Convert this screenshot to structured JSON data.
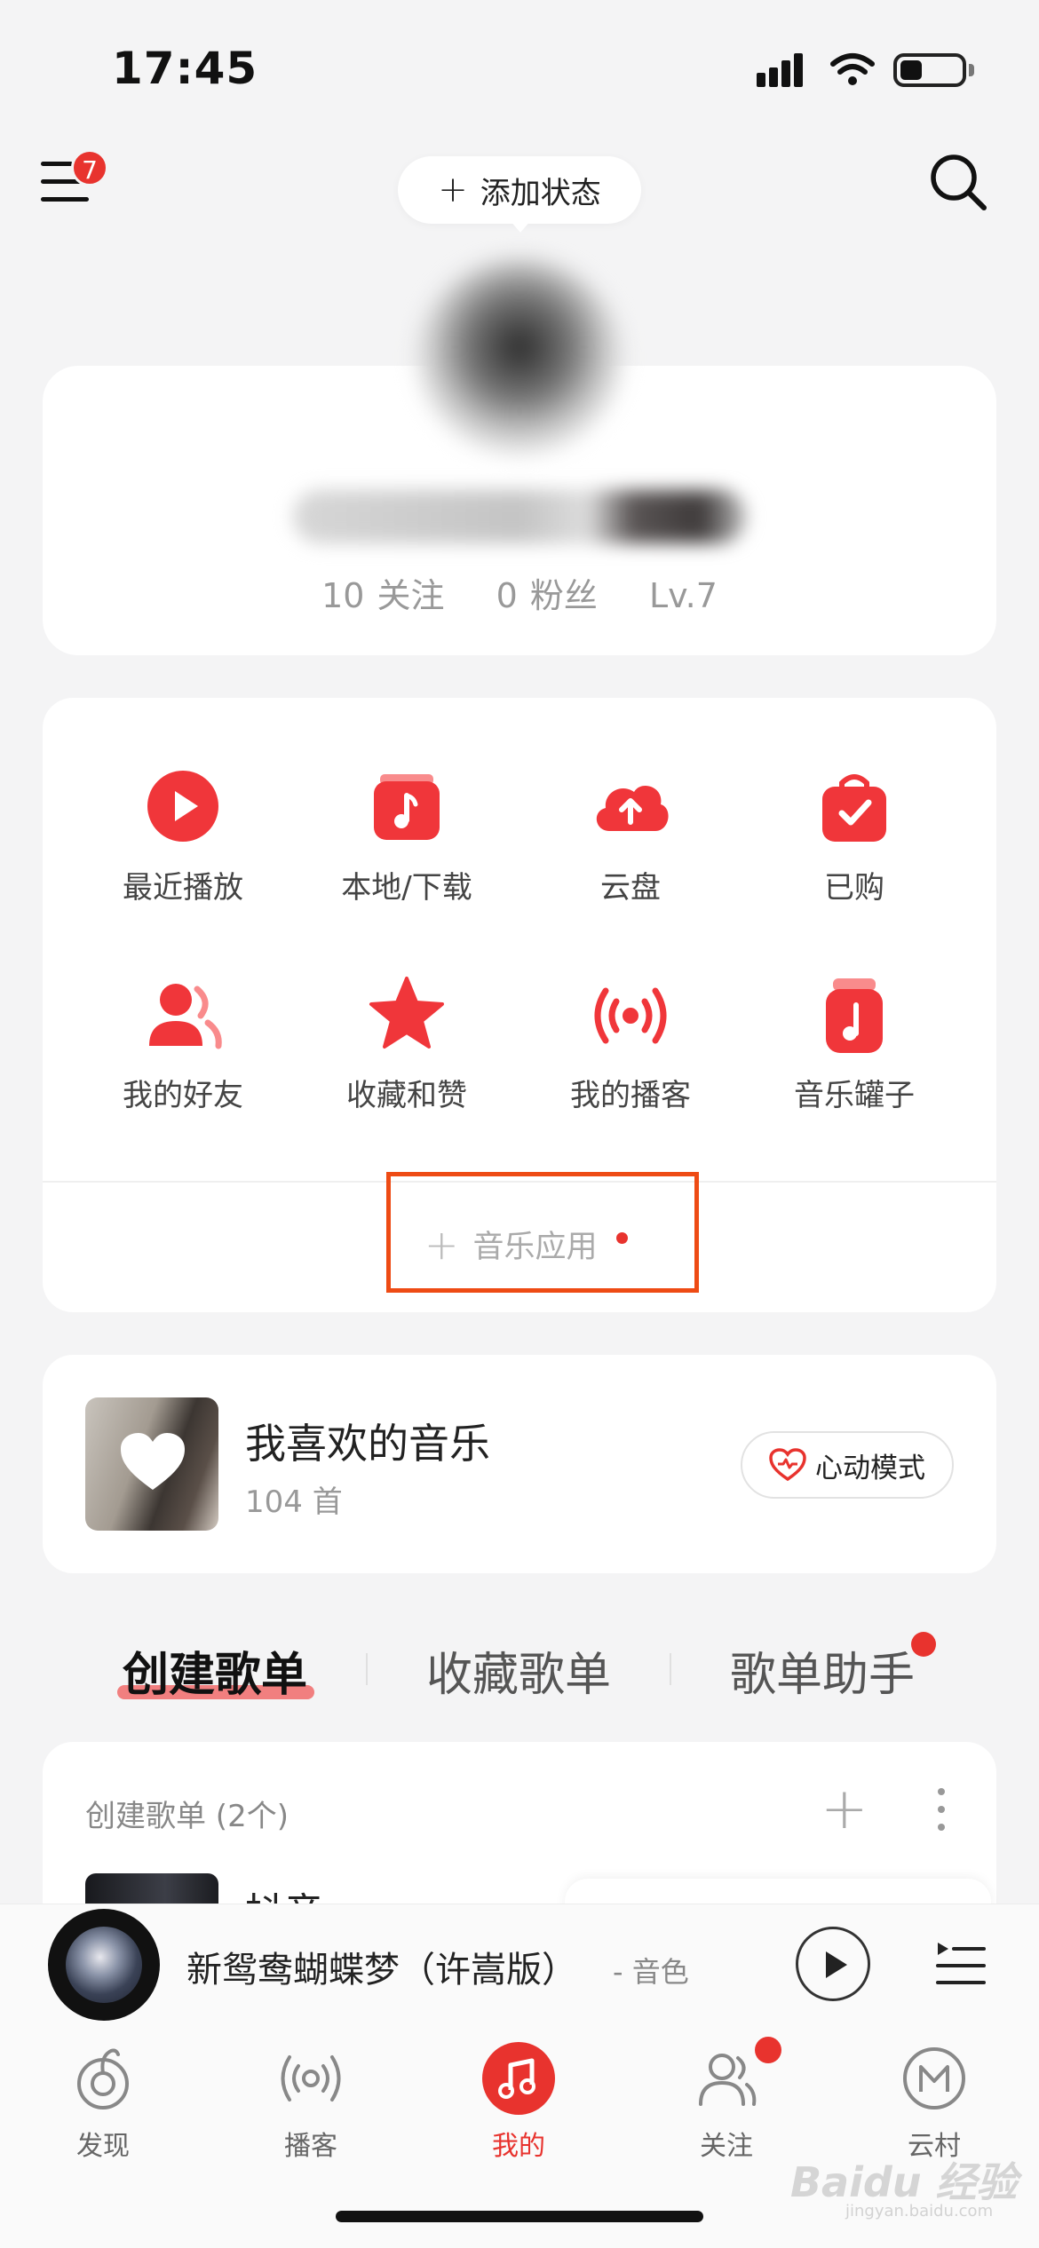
{
  "status_bar": {
    "time": "17:45"
  },
  "header": {
    "notification_count": "7",
    "add_status_label": "添加状态"
  },
  "profile": {
    "following": "10 关注",
    "followers": "0 粉丝",
    "level": "Lv.7"
  },
  "functions": [
    {
      "label": "最近播放",
      "icon": "play-circle-icon"
    },
    {
      "label": "本地/下载",
      "icon": "local-music-icon"
    },
    {
      "label": "云盘",
      "icon": "cloud-upload-icon"
    },
    {
      "label": "已购",
      "icon": "purchased-bag-icon"
    },
    {
      "label": "我的好友",
      "icon": "friends-icon"
    },
    {
      "label": "收藏和赞",
      "icon": "star-icon"
    },
    {
      "label": "我的播客",
      "icon": "podcast-broadcast-icon"
    },
    {
      "label": "音乐罐子",
      "icon": "music-jar-icon"
    }
  ],
  "music_apps_label": "音乐应用",
  "favorites": {
    "title": "我喜欢的音乐",
    "count": "104 首",
    "heartbeat_label": "心动模式"
  },
  "playlist_tabs": [
    "创建歌单",
    "收藏歌单",
    "歌单助手"
  ],
  "created_playlists": {
    "header": "创建歌单 (2个)",
    "first_item": "抖音"
  },
  "now_playing": {
    "title": "新鸳鸯蝴蝶梦（许嵩版）",
    "artist": "- 音色"
  },
  "bottom_nav": [
    "发现",
    "播客",
    "我的",
    "关注",
    "云村"
  ],
  "watermark": {
    "brand": "Baidu 经验",
    "url": "jingyan.baidu.com"
  },
  "colors": {
    "accent": "#e8332e",
    "highlight_box": "#ee4b14",
    "background": "#f4f4f5"
  }
}
